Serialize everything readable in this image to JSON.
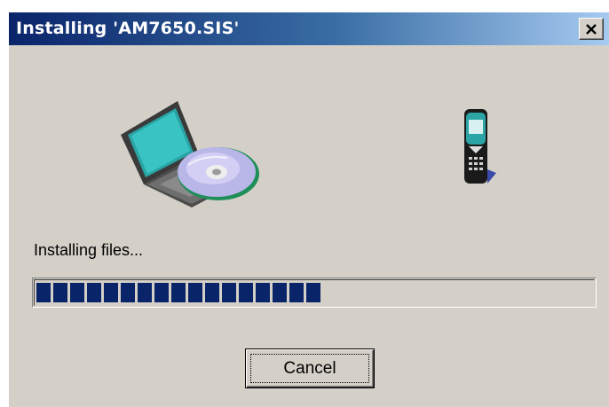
{
  "window": {
    "title": "Installing 'AM7650.SIS'",
    "close_symbol": "X"
  },
  "icons": {
    "source": "laptop-with-cd-icon",
    "target": "mobile-phone-icon",
    "close": "close-icon"
  },
  "status": {
    "label": "Installing files..."
  },
  "progress": {
    "fraction": 0.53,
    "style": "segmented-blocks",
    "color": "#0a246a"
  },
  "buttons": {
    "cancel_label": "Cancel"
  },
  "colors": {
    "title_gradient_start": "#0a246a",
    "title_gradient_end": "#a6caf0",
    "dialog_face": "#d4d0c8"
  }
}
